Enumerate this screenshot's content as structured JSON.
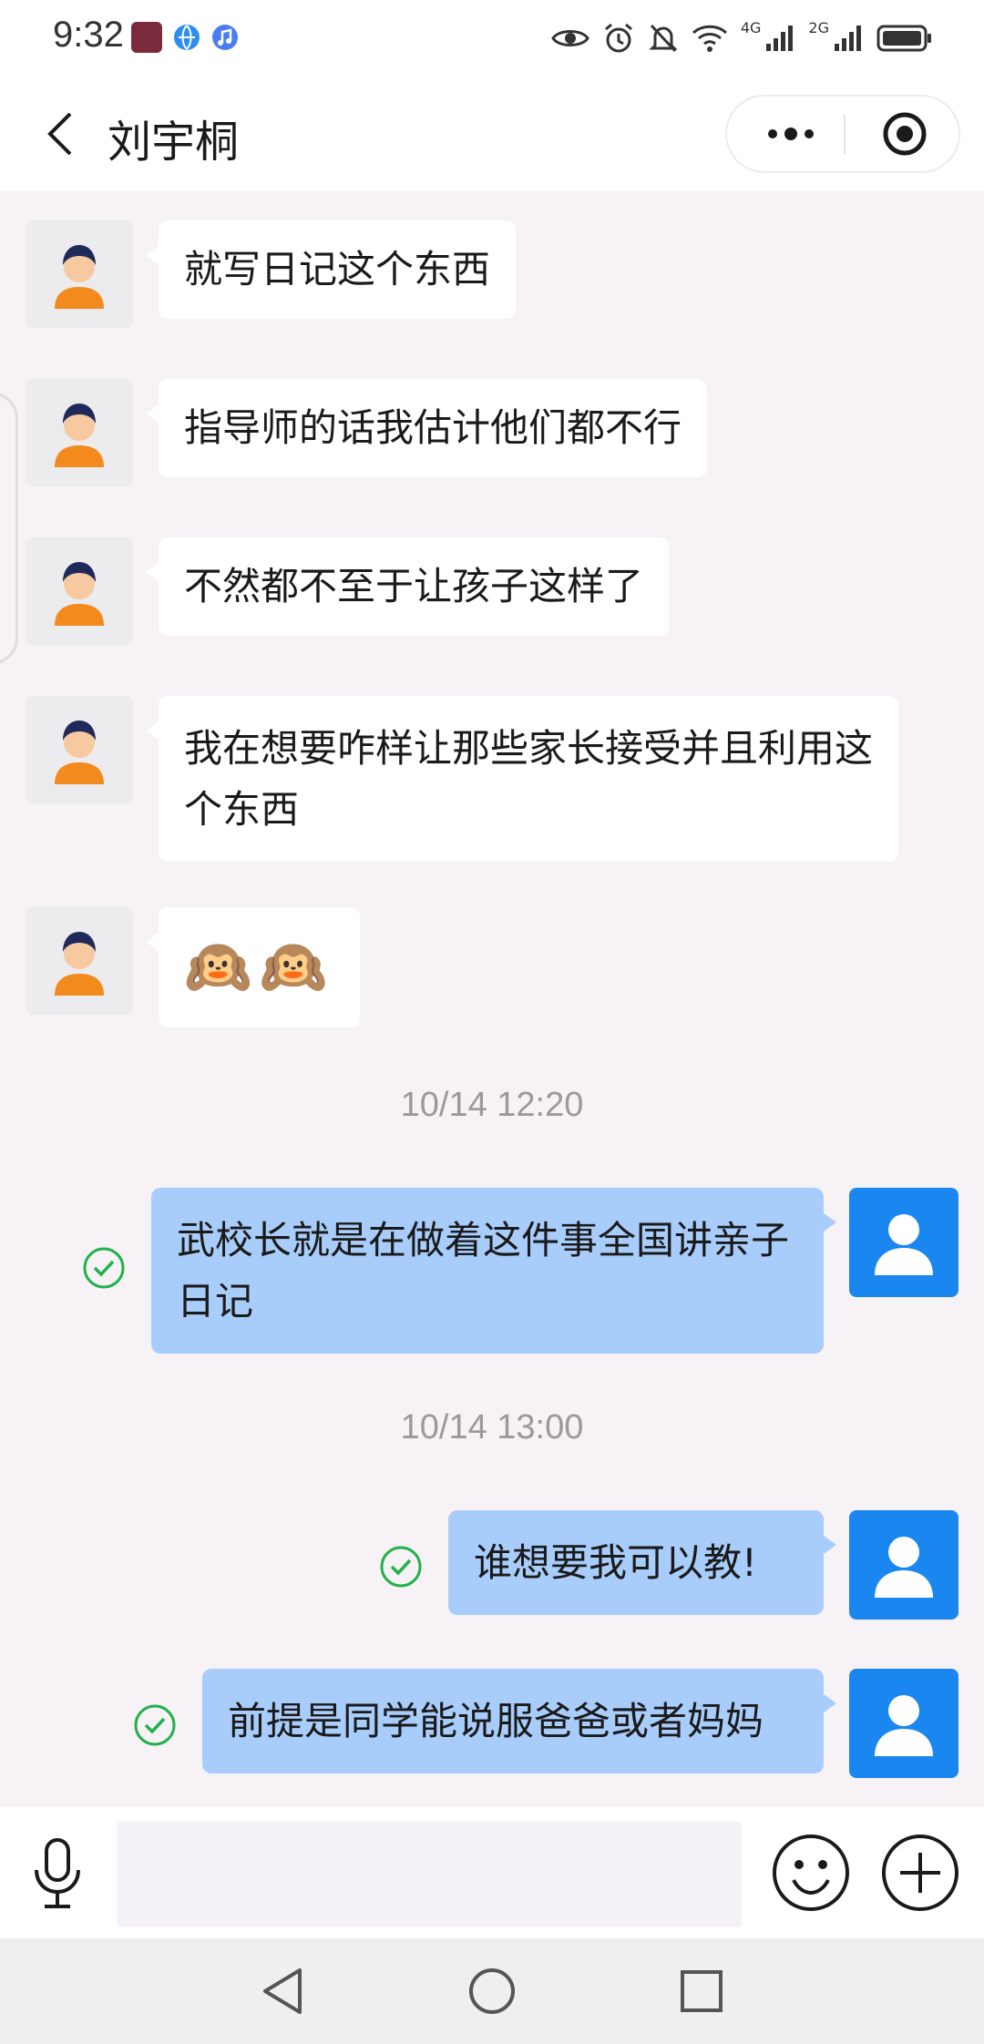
{
  "status_bar": {
    "time": "9:32",
    "net_label_1": "4G",
    "net_label_2": "2G"
  },
  "header": {
    "title": "刘宇桐"
  },
  "messages_in": [
    {
      "text": "就写日记这个东西"
    },
    {
      "text": "指导师的话我估计他们都不行"
    },
    {
      "text": "不然都不至于让孩子这样了"
    },
    {
      "text": "我在想要咋样让那些家长接受并且利用这个东西"
    },
    {
      "text": "🙉🙉"
    }
  ],
  "timestamps": [
    "10/14 12:20",
    "10/14 13:00"
  ],
  "messages_out": [
    {
      "text": "武校长就是在做着这件事全国讲亲子日记"
    },
    {
      "text": "谁想要我可以教!"
    },
    {
      "text": "前提是同学能说服爸爸或者妈妈"
    }
  ],
  "input": {
    "value": ""
  },
  "colors": {
    "chat_bg": "#f6f2f5",
    "outgoing_bubble": "#a9cdfb",
    "incoming_bubble": "#ffffff",
    "outgoing_avatar": "#1a87f0",
    "sent_check": "#22b14c"
  }
}
